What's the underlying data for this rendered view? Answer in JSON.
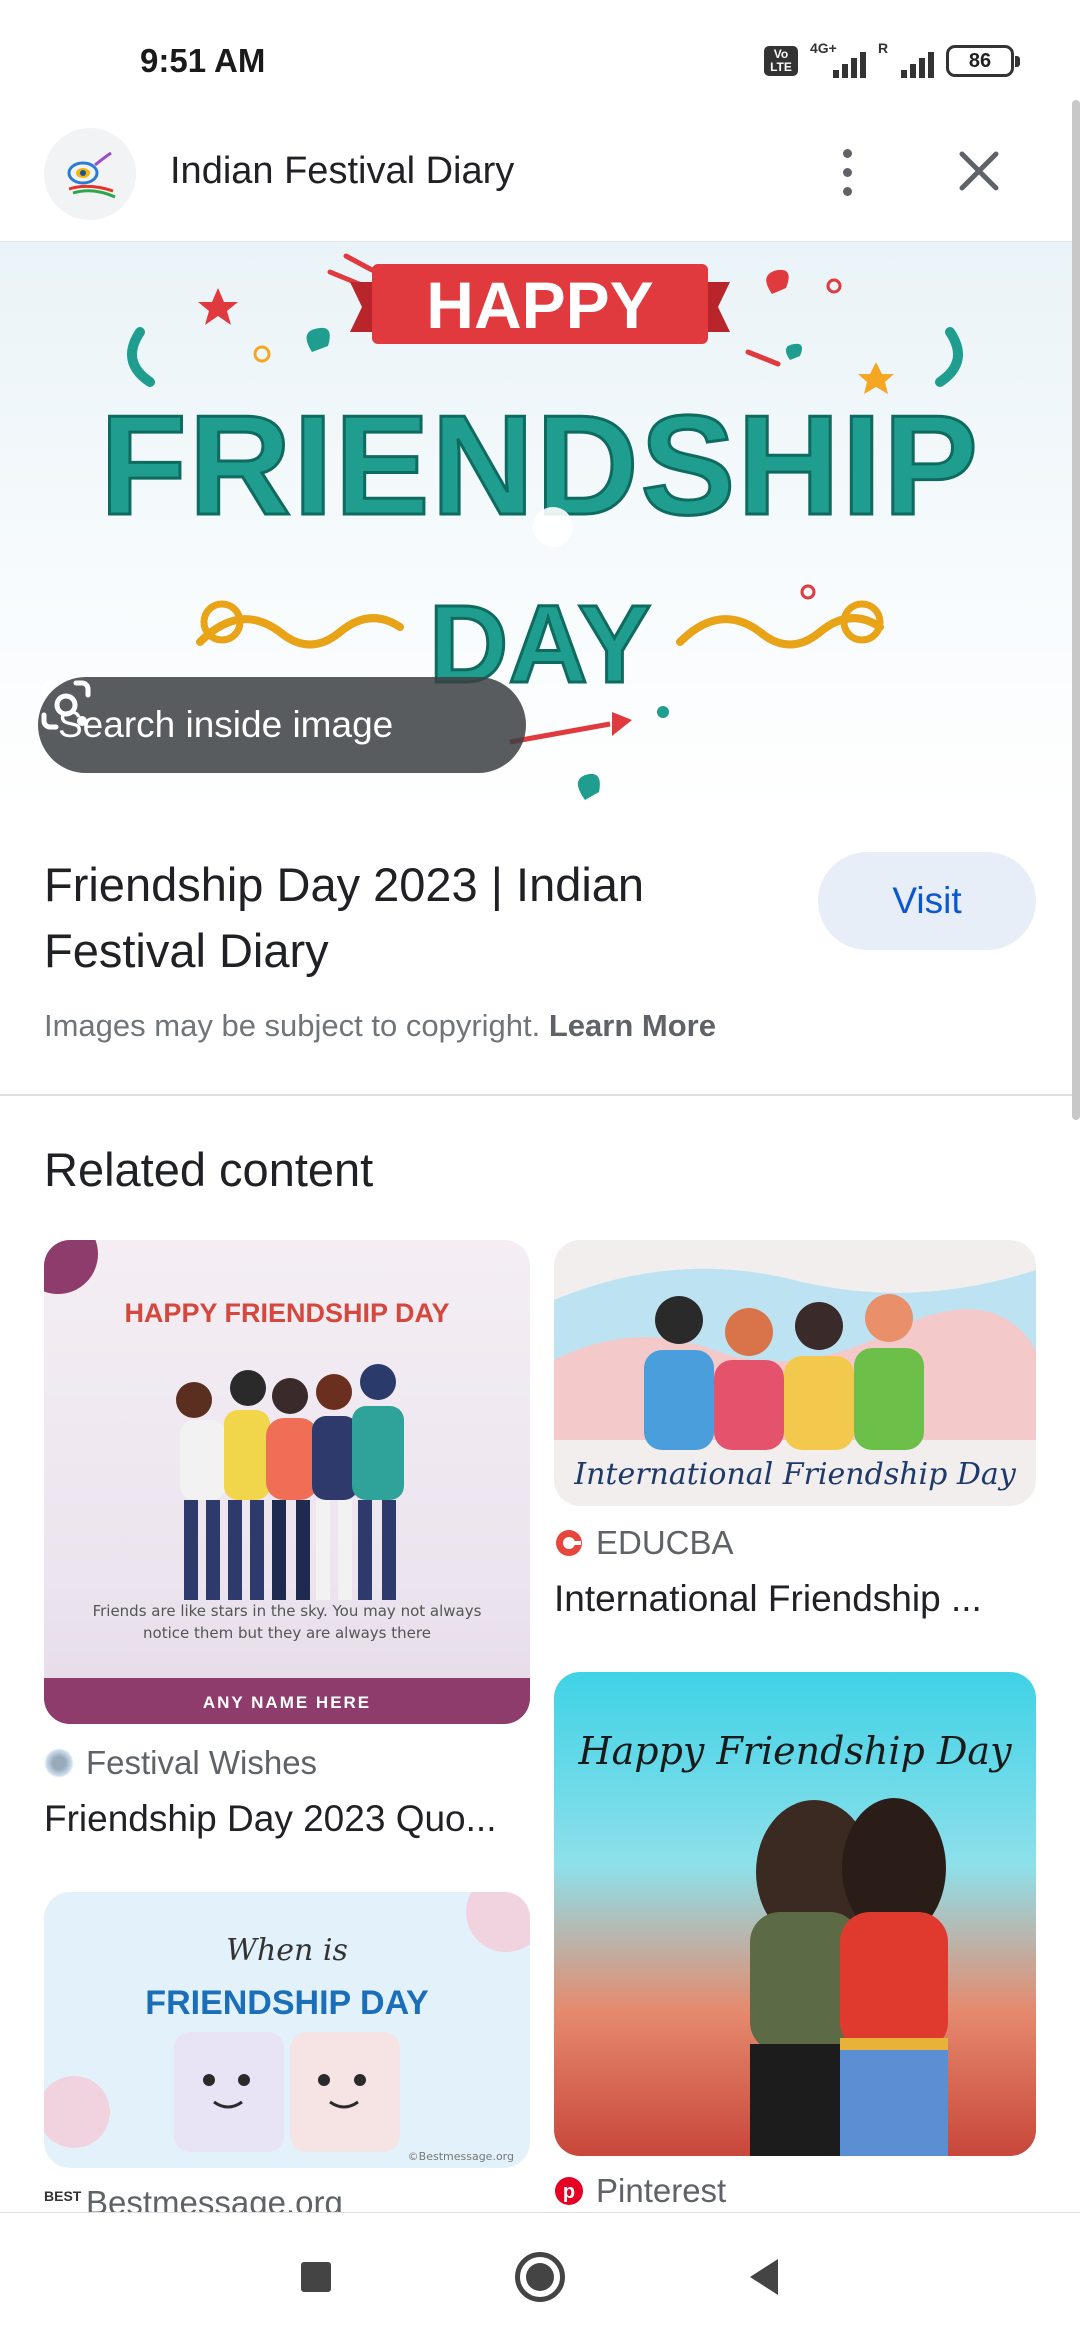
{
  "status_bar": {
    "time": "9:51 AM",
    "volte": "Vo LTE",
    "network_1": "4G+",
    "network_2": "R",
    "battery": "86"
  },
  "header": {
    "site_name": "Indian Festival Diary"
  },
  "hero": {
    "image_text_happy": "HAPPY",
    "image_text_friendship": "FRIENDSHIP",
    "image_text_day": "DAY",
    "search_inside_label": "Search inside image"
  },
  "result": {
    "title": "Friendship Day 2023 | Indian Festival Diary",
    "visit_label": "Visit",
    "copyright_text": "Images may be subject to copyright.",
    "learn_more": "Learn More"
  },
  "related": {
    "heading": "Related content",
    "items": [
      {
        "source": "Festival Wishes",
        "caption": "Friendship Day 2023 Quo...",
        "img_heading": "HAPPY FRIENDSHIP DAY",
        "img_quote": "Friends are like stars in the sky. You may not always notice them but they are always there",
        "img_footer": "ANY NAME HERE"
      },
      {
        "source": "EDUCBA",
        "caption": "International Friendship ...",
        "img_text": "International Friendship Day"
      },
      {
        "source": "Bestmessage.org",
        "img_text_top": "When is",
        "img_text_main": "FRIENDSHIP DAY",
        "img_credit": "©Bestmessage.org"
      },
      {
        "source": "Pinterest",
        "img_text": "Happy Friendship Day"
      }
    ]
  },
  "colors": {
    "accent_blue": "#0b57d0",
    "visit_bg": "#e8eef8",
    "teal": "#1f9e8f",
    "red_ribbon": "#e0393e"
  },
  "icons": {
    "more": "more-vert-icon",
    "close": "close-icon",
    "lens": "lens-icon",
    "nav_recents": "recents-square-icon",
    "nav_home": "home-circle-icon",
    "nav_back": "back-triangle-icon"
  }
}
